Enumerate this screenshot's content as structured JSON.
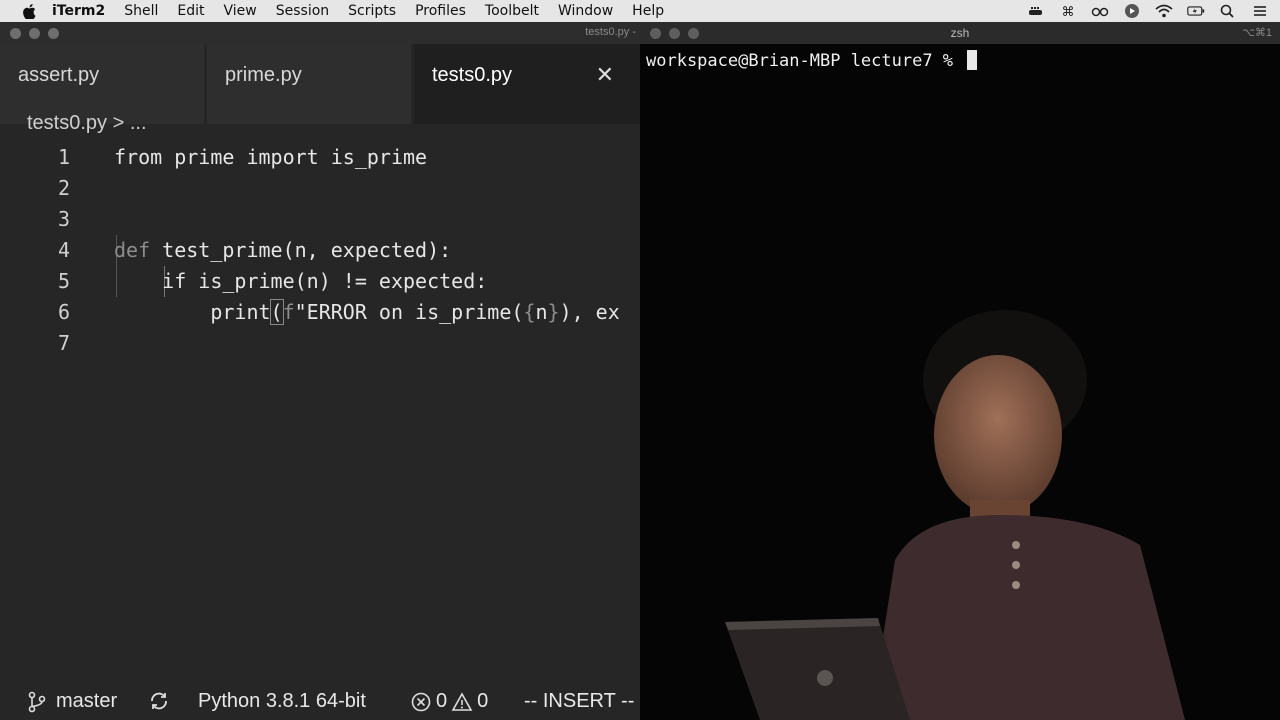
{
  "menubar": {
    "app": "iTerm2",
    "items": [
      "Shell",
      "Edit",
      "View",
      "Session",
      "Scripts",
      "Profiles",
      "Toolbelt",
      "Window",
      "Help"
    ]
  },
  "editor": {
    "window_title": "tests0.py -",
    "tabs": [
      {
        "label": "assert.py",
        "active": false
      },
      {
        "label": "prime.py",
        "active": false
      },
      {
        "label": "tests0.py",
        "active": true
      }
    ],
    "tab_close": "✕",
    "breadcrumb": "tests0.py > ...",
    "lines": [
      {
        "num": "1"
      },
      {
        "num": "2"
      },
      {
        "num": "3"
      },
      {
        "num": "4"
      },
      {
        "num": "5"
      },
      {
        "num": "6"
      },
      {
        "num": "7"
      }
    ],
    "statusbar": {
      "branch": "master",
      "interpreter": "Python 3.8.1 64-bit",
      "errors": "0",
      "warnings": "0",
      "mode": "-- INSERT --"
    }
  },
  "terminal": {
    "window_title": "zsh",
    "shortcut": "⌥⌘1",
    "prompt": "workspace@Brian-MBP lecture7 % "
  },
  "colors": {
    "editor_bg": "#262626",
    "terminal_bg": "#050505",
    "menubar_bg": "#e6e6e6"
  }
}
